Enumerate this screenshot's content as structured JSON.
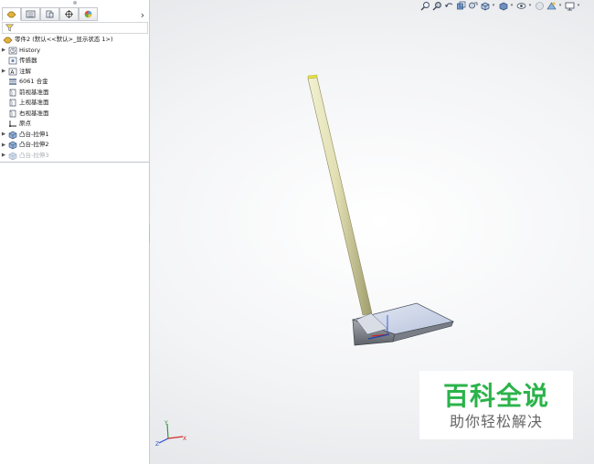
{
  "tree": {
    "root": "零件2  (默认<<默认>_显示状态 1>)",
    "items": [
      {
        "label": "History",
        "icon": "history-icon",
        "expandable": true,
        "dim": false
      },
      {
        "label": "传感器",
        "icon": "sensor-icon",
        "expandable": false,
        "dim": false
      },
      {
        "label": "注解",
        "icon": "annotation-icon",
        "expandable": true,
        "dim": false
      },
      {
        "label": "6061 合金",
        "icon": "material-icon",
        "expandable": false,
        "dim": false
      },
      {
        "label": "前视基准面",
        "icon": "plane-icon",
        "expandable": false,
        "dim": false
      },
      {
        "label": "上视基准面",
        "icon": "plane-icon",
        "expandable": false,
        "dim": false
      },
      {
        "label": "右视基准面",
        "icon": "plane-icon",
        "expandable": false,
        "dim": false
      },
      {
        "label": "原点",
        "icon": "origin-icon",
        "expandable": false,
        "dim": false
      },
      {
        "label": "凸台-拉伸1",
        "icon": "extrude-icon",
        "expandable": true,
        "dim": false
      },
      {
        "label": "凸台-拉伸2",
        "icon": "extrude-icon",
        "expandable": true,
        "dim": false
      },
      {
        "label": "凸台-拉伸3",
        "icon": "extrude-icon",
        "expandable": true,
        "dim": true
      }
    ]
  },
  "tabs": [
    "feature-manager",
    "property-manager",
    "configuration-manager",
    "dimxpert-manager",
    "display-manager"
  ],
  "tab_more_glyph": "›",
  "triad": {
    "x": "X",
    "y": "Y",
    "z": "Z"
  },
  "watermark": {
    "title": "百科全说",
    "subtitle": "助你轻松解决"
  },
  "colors": {
    "accent_green": "#2bb34a",
    "handle": "#d9d7a8",
    "blade": "#c6cfe3"
  }
}
